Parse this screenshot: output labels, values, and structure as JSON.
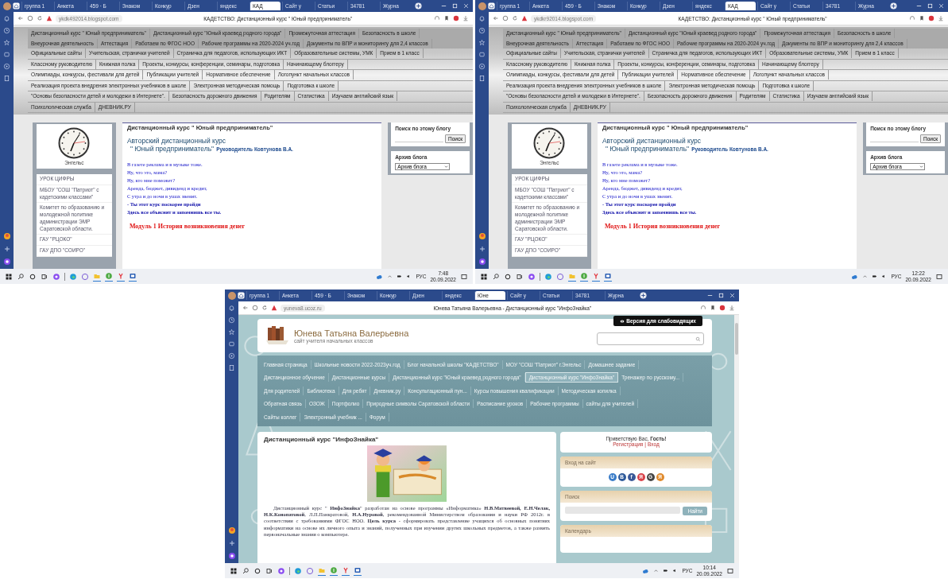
{
  "screens": [
    {
      "kind": "blog",
      "browser": {
        "tabs": [
          {
            "label": "группа 1",
            "selected": false
          },
          {
            "label": "Анкета",
            "selected": false
          },
          {
            "label": "459 · Б",
            "selected": false
          },
          {
            "label": "Знаком",
            "selected": false
          },
          {
            "label": "Конкур",
            "selected": false
          },
          {
            "label": "Дзен",
            "selected": false
          },
          {
            "label": "яндекс",
            "selected": false
          },
          {
            "label": "КАД",
            "selected": true
          },
          {
            "label": "Сайт у",
            "selected": false
          },
          {
            "label": "Статьи",
            "selected": false
          },
          {
            "label": "34781",
            "selected": false
          },
          {
            "label": "Журна",
            "selected": false
          }
        ],
        "url": "ykdk492014.blogspot.com",
        "title": "КАДЕТСТВО: Дистанционный курс \" Юный предприниматель\""
      },
      "page": {
        "menu_groups": [
          {
            "kind": "primary",
            "rows": [
              {
                "items": [
                  "Дистанционный курс \" Юный предприниматель\"",
                  "Дистанционный курс \"Юный краевед родного города\"",
                  "Промежуточная аттестация",
                  "Безопасность в школе"
                ]
              },
              {
                "items": [
                  "Внеурочная деятельность",
                  "Аттестация",
                  "Работаем по ФГОС НОО",
                  "Рабочие программы на 2020-2024 уч.год",
                  "Документы по ВПР и мониторингу для 2,4 классов"
                ]
              }
            ]
          },
          {
            "kind": "secondary",
            "rows": [
              {
                "items": [
                  "Официальные сайты",
                  "Учительская, странички учителей",
                  "Страничка для педагогов, использующих ИКТ",
                  "Образовательные системы, УМК",
                  "Прием в 1 класс"
                ]
              },
              {
                "items": [
                  "Классному руководителю",
                  "Книжная полка",
                  "Проекты, конкурсы, конференции, семинары, подготовка",
                  "Начинающему блоггеру"
                ]
              },
              {
                "items": [
                  "Олимпиады, конкурсы, фестивали для детей",
                  "Публикации учителей",
                  "Нормативное обеспечение",
                  "Логопункт начальных классов"
                ]
              },
              {
                "items": [
                  "Реализация проекта внедрения электронных учебников в школе",
                  "Электронная методическая помощь",
                  "Подготовка к школе"
                ]
              },
              {
                "items": [
                  "\"Основы безопасности детей и молодежи в Интернете\".",
                  "Безопасность дорожного движения",
                  "Родителям",
                  "Статистика",
                  "Изучаем английский язык"
                ]
              },
              {
                "items": [
                  "Психологическая служба",
                  "ДНЕВНИК.РУ"
                ]
              }
            ]
          }
        ],
        "clock_caption": "Энгельс",
        "links": [
          "УРОК ЦИФРЫ",
          "МБОУ \"СОШ \"Патриот\" с кадетскими классами\"",
          "Комитет по образованию и молодежной политике администрации ЭМР Саратовской области.",
          "ГАУ \"РЦОКО\"",
          "ГАУ ДПО \"СОИРО\""
        ],
        "post_title": "Дистанционный курс \" Юный предприниматель\"",
        "heading": [
          "Авторский дистанционный курс",
          "\" Юный предприниматель\""
        ],
        "author": "Руководитель Ковтунова В.А.",
        "poem": [
          "В газете реклама и в музыке тоже.",
          "Ну, что это, мама?",
          "Ну, кто мне поможет?",
          "Аренда, бюджет, дивиденд и кредит,",
          "С утра и до ночи в ушах звенит."
        ],
        "bold_lines": [
          "- Ты этот курс поскорее пройди",
          "Здесь все объяснят и запомнишь все ты."
        ],
        "module": "Модуль 1 История возникновения денег",
        "search_title": "Поиск по этому блогу",
        "search_button": "Поиск",
        "archive_title": "Архив блога",
        "archive_select": "Архив блога"
      },
      "taskbar": {
        "time": "7:48",
        "date": "20.09.2022",
        "language": "РУС"
      }
    },
    {
      "kind": "blog",
      "browser": {
        "tabs": [
          {
            "label": "группа 1",
            "selected": false
          },
          {
            "label": "Анкета",
            "selected": false
          },
          {
            "label": "459 · Б",
            "selected": false
          },
          {
            "label": "Знаком",
            "selected": false
          },
          {
            "label": "Конкур",
            "selected": false
          },
          {
            "label": "Дзен",
            "selected": false
          },
          {
            "label": "яндекс",
            "selected": false
          },
          {
            "label": "КАД",
            "selected": true
          },
          {
            "label": "Сайт у",
            "selected": false
          },
          {
            "label": "Статьи",
            "selected": false
          },
          {
            "label": "34781",
            "selected": false
          },
          {
            "label": "Журна",
            "selected": false
          }
        ],
        "url": "ykdkr92014.blogspot.com",
        "title": "КАДЕТСТВО: Дистанционный курс \" Юный предприниматель\""
      },
      "page": {
        "menu_groups": [
          {
            "kind": "primary",
            "rows": [
              {
                "items": [
                  "Дистанционный курс \" Юный предприниматель\"",
                  "Дистанционный курс \"Юный краевед родного города\"",
                  "Промежуточная аттестация",
                  "Безопасность в школе"
                ]
              },
              {
                "items": [
                  "Внеурочная деятельность",
                  "Аттестация",
                  "Работаем по ФГОС НОО",
                  "Рабочие программы на 2020-2024 уч.год",
                  "Документы по ВПР и мониторингу для 2,4 классов"
                ]
              }
            ]
          },
          {
            "kind": "secondary",
            "rows": [
              {
                "items": [
                  "Официальные сайты",
                  "Учительская, странички учителей",
                  "Страничка для педагогов, использующих ИКТ",
                  "Образовательные системы, УМК",
                  "Прием в 1 класс"
                ]
              },
              {
                "items": [
                  "Классному руководителю",
                  "Книжная полка",
                  "Проекты, конкурсы, конференции, семинары, подготовка",
                  "Начинающему блоггеру"
                ]
              },
              {
                "items": [
                  "Олимпиады, конкурсы, фестивали для детей",
                  "Публикации учителей",
                  "Нормативное обеспечение",
                  "Логопункт начальных классов"
                ]
              },
              {
                "items": [
                  "Реализация проекта внедрения электронных учебников в школе",
                  "Электронная методическая помощь",
                  "Подготовка к школе"
                ]
              },
              {
                "items": [
                  "\"Основы безопасности детей и молодежи в Интернете\".",
                  "Безопасность дорожного движения",
                  "Родителям",
                  "Статистика",
                  "Изучаем английский язык"
                ]
              },
              {
                "items": [
                  "Психологическая служба",
                  "ДНЕВНИК.РУ"
                ]
              }
            ]
          }
        ],
        "clock_caption": "Энгельс",
        "links": [
          "УРОК ЦИФРЫ",
          "МБОУ \"СОШ \"Патриот\" с кадетскими классами\"",
          "Комитет по образованию и молодежной политике администрации ЭМР Саратовской области.",
          "ГАУ \"РЦОКО\"",
          "ГАУ ДПО \"СОИРО\""
        ],
        "post_title": "Дистанционный курс \" Юный предприниматель\"",
        "heading": [
          "Авторский дистанционный курс",
          "\" Юный предприниматель\""
        ],
        "author": "Руководитель Ковтунова В.А.",
        "poem": [
          "В газете реклама и в музыке тоже.",
          "Ну, что это, мама?",
          "Ну, кто мне поможет?",
          "Аренда, бюджет, дивиденд и кредит,",
          "С утра и до ночи в ушах звенит."
        ],
        "bold_lines": [
          "- Ты этот курс поскорее пройди",
          "Здесь все объяснят и запомнишь все ты."
        ],
        "module": "Модуль 1 История возникновения денег",
        "search_title": "Поиск по этому блогу",
        "search_button": "Поиск",
        "archive_title": "Архив блога",
        "archive_select": "Архив блога"
      },
      "taskbar": {
        "time": "12:22",
        "date": "20.09.2022",
        "language": "РУС"
      }
    },
    {
      "kind": "ucoz",
      "browser": {
        "tabs": [
          {
            "label": "группа 1",
            "selected": false
          },
          {
            "label": "Анкета",
            "selected": false
          },
          {
            "label": "459 · Б",
            "selected": false
          },
          {
            "label": "Знаком",
            "selected": false
          },
          {
            "label": "Конкур",
            "selected": false
          },
          {
            "label": "Дзен",
            "selected": false
          },
          {
            "label": "яндекс",
            "selected": false
          },
          {
            "label": "Юне",
            "selected": true
          },
          {
            "label": "Сайт у",
            "selected": false
          },
          {
            "label": "Статьи",
            "selected": false
          },
          {
            "label": "34781",
            "selected": false
          },
          {
            "label": "Журна",
            "selected": false
          }
        ],
        "url": "yuneva8.ucoz.ru",
        "title": "Юнева Татьяна Валерьевна - Дистанционный курс \"ИнфоЗнайка\""
      },
      "page": {
        "accessibility_button": "Версия для слабовидящих",
        "site_name": "Юнева Татьяна Валерьевна",
        "site_subtitle": "сайт учителя начальных классов",
        "menu": [
          {
            "items": [
              {
                "label": "Главная страница",
                "selected": false
              },
              {
                "label": "Школьные новости 2022-2023уч.год",
                "selected": false
              },
              {
                "label": "Блог начальной школы \"КАДЕТСТВО\"",
                "selected": false
              },
              {
                "label": "МОУ \"СОШ \"Патриот\" г.Энгельс",
                "selected": false
              },
              {
                "label": "Домашнее задание",
                "selected": false
              }
            ]
          },
          {
            "items": [
              {
                "label": "Дистанционное обучение",
                "selected": false
              },
              {
                "label": "Дистанционные курсы",
                "selected": false
              },
              {
                "label": "Дистанционный курс \"Юный краевед родного города\"",
                "selected": false
              },
              {
                "label": "Дистанционный курс \"ИнфоЗнайка\"",
                "selected": true
              },
              {
                "label": "Тренажер по русскому...",
                "selected": false
              }
            ]
          },
          {
            "items": [
              {
                "label": "Для родителей",
                "selected": false
              },
              {
                "label": "Библиотека",
                "selected": false
              },
              {
                "label": "Для ребят",
                "selected": false
              },
              {
                "label": "Дневник.ру",
                "selected": false
              },
              {
                "label": "Консультационный пун...",
                "selected": false
              },
              {
                "label": "Курсы повышения квалификации",
                "selected": false
              },
              {
                "label": "Методическая копилка",
                "selected": false
              }
            ]
          },
          {
            "items": [
              {
                "label": "Обратная связь",
                "selected": false
              },
              {
                "label": "ОЗОЖ",
                "selected": false
              },
              {
                "label": "Портфолио",
                "selected": false
              },
              {
                "label": "Природные символы Саратовской области",
                "selected": false
              },
              {
                "label": "Расписание уроков",
                "selected": false
              },
              {
                "label": "Рабочие программы",
                "selected": false
              },
              {
                "label": "сайты для учителей",
                "selected": false
              }
            ]
          },
          {
            "items": [
              {
                "label": "Сайты коллег",
                "selected": false
              },
              {
                "label": "Электронный учебник ...",
                "selected": false
              },
              {
                "label": "Форум",
                "selected": false
              }
            ]
          }
        ],
        "post_title": "Дистанционный курс \"ИнфоЗнайка\"",
        "picture": {
          "kind": "picture"
        },
        "paragraph": "Дистанционный курс \" **ИнфоЗнайка**\" разработан на основе программы «Информатика» **Н.В.Матвеевой, Е.Н.Челак, Н.К.Конопатовой**, Л.П.Панкратовой, **Н.А.Нуровой**, рекомендованной Министерством образования и науки РФ 2012г. в соответствии с требованиями ФГОС НОО. **Цель курса** - сформировать представление учащихся об основных понятиях информатики на основе их личного опыта и знаний, полученных при изучении других школьных предметов, а также развить первоначальные знания о компьютере.",
        "greeting": "Приветствую Вас, **Гость!**",
        "auth_links": [
          "Регистрация",
          "Вход"
        ],
        "auth_separator": "|",
        "blocks": [
          {
            "kind": "social",
            "title": "Вход на сайт",
            "icons": [
              {
                "label": "U",
                "color": "#3a7cc8"
              },
              {
                "label": "B",
                "color": "#2e5a9a"
              },
              {
                "label": "f",
                "color": "#3b5998"
              },
              {
                "label": "Я",
                "color": "#d9434a"
              },
              {
                "label": "G",
                "color": "#444444"
              },
              {
                "label": "Я",
                "color": "#e08a2c"
              }
            ]
          },
          {
            "kind": "search",
            "title": "Поиск",
            "button": "Найти"
          },
          {
            "kind": "calendar",
            "title": "Календарь"
          }
        ]
      },
      "taskbar": {
        "time": "10:14",
        "date": "20.09.2022",
        "language": "РУС"
      }
    }
  ]
}
